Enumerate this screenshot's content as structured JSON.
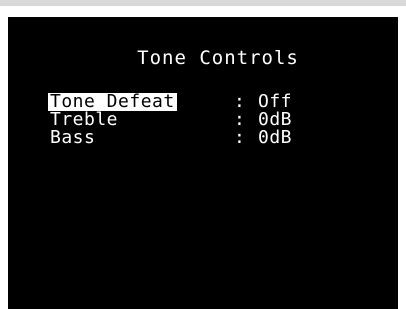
{
  "screen": {
    "title": "Tone Controls",
    "items": [
      {
        "label": "Tone Defeat",
        "separator": ":",
        "value": "Off",
        "selected": true
      },
      {
        "label": "Treble",
        "separator": ":",
        "value": "0dB",
        "selected": false
      },
      {
        "label": "Bass",
        "separator": ":",
        "value": "0dB",
        "selected": false
      }
    ]
  },
  "colors": {
    "background": "#000000",
    "text": "#ffffff",
    "highlight": "#ffffff"
  }
}
